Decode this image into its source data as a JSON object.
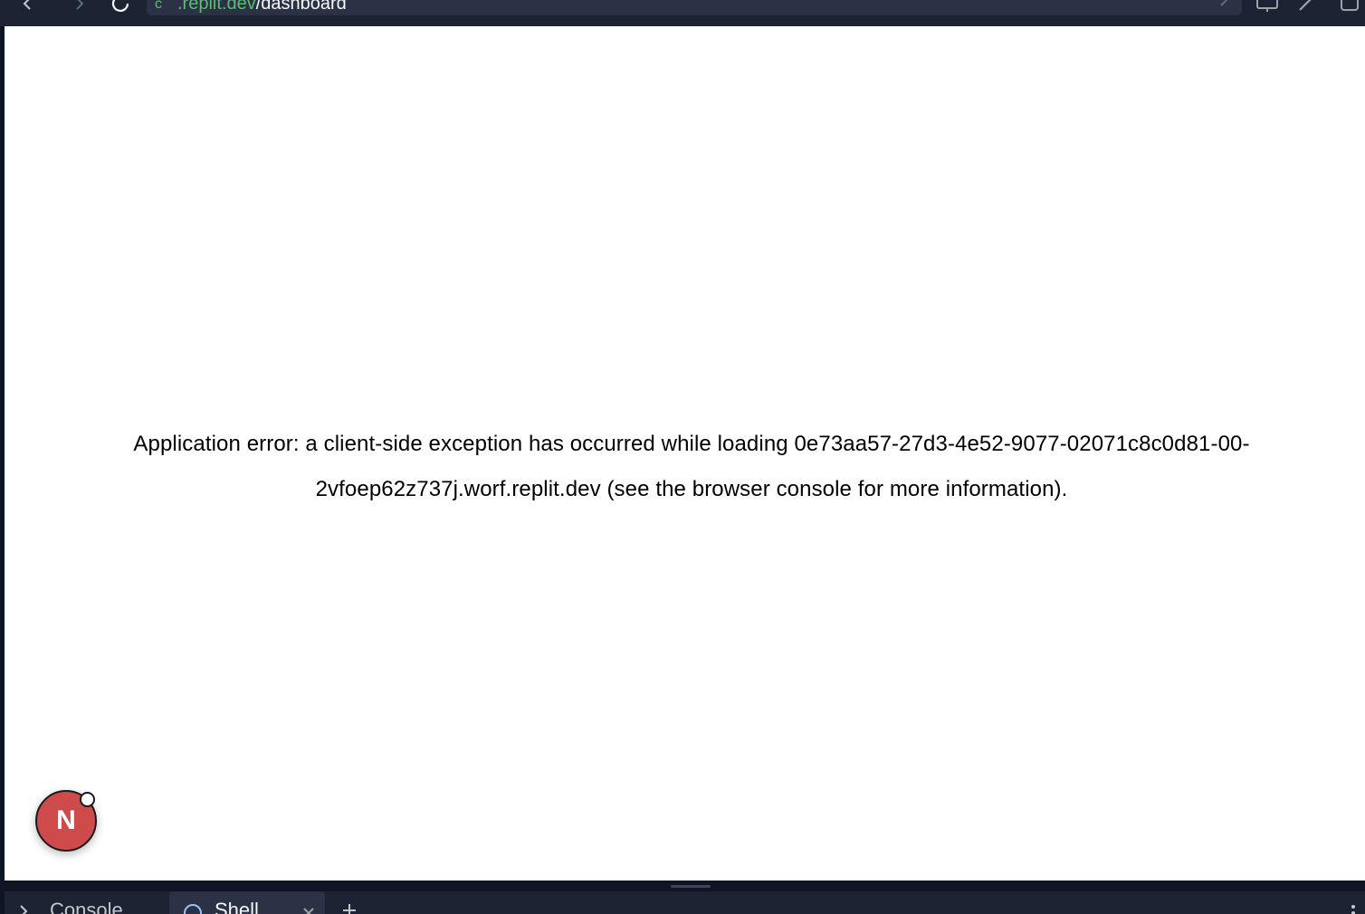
{
  "browser": {
    "url_host": ".replit.dev",
    "url_path": "/dashboard",
    "icons": [
      "back-icon",
      "forward-icon",
      "reload-icon",
      "chevron-right-icon",
      "devices-icon",
      "edit-icon",
      "window-icon"
    ]
  },
  "page": {
    "error_message": "Application error: a client-side exception has occurred while loading 0e73aa57-27d3-4e52-9077-02071c8c0d81-00-2vfoep62z737j.worf.replit.dev (see the browser console for more information).",
    "badge_letter": "N"
  },
  "bottom_panel": {
    "tabs": [
      {
        "label": "Console",
        "icon": "chevron-right-icon",
        "active": false
      },
      {
        "label": "Shell",
        "icon": "shell-icon",
        "active": true
      }
    ],
    "add_icon": "plus-icon",
    "menu_icon": "kebab-menu-icon"
  },
  "colors": {
    "chrome_bg": "#1c2333",
    "url_bar_bg": "#2b3245",
    "url_host": "#5bbd72",
    "badge_red": "#cf4b4b",
    "page_bg": "#ffffff"
  }
}
